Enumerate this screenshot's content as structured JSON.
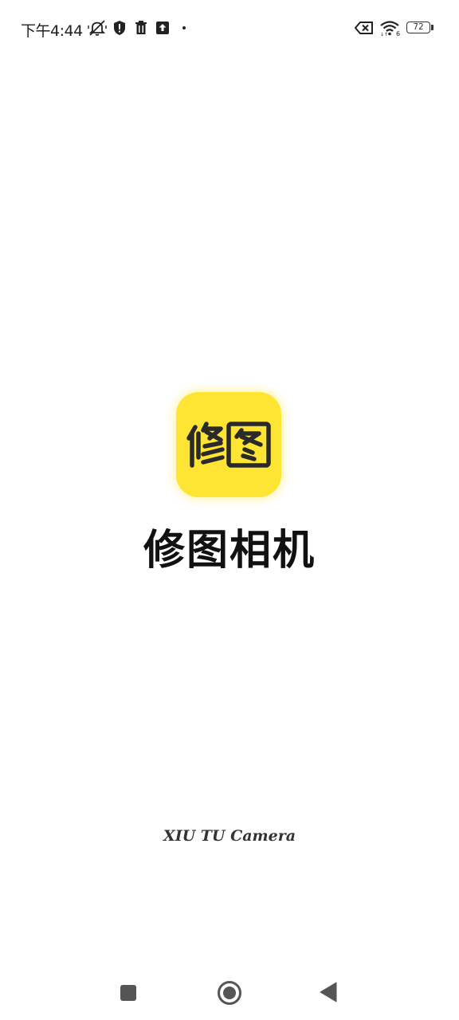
{
  "status_bar": {
    "time": "下午4:44",
    "battery_level": "72",
    "icons_left": [
      "mute-icon",
      "shield-icon",
      "trash-icon",
      "upload-icon",
      "dot-icon"
    ],
    "icons_right": [
      "sim-no-signal-icon",
      "wifi-icon",
      "battery-icon"
    ]
  },
  "splash": {
    "logo_text": "修图",
    "app_name": "修图相机",
    "subtitle": "XIU TU Camera",
    "logo_color": "#ffe533"
  },
  "nav_bar": {
    "buttons": [
      "recent-apps-button",
      "home-button",
      "back-button"
    ]
  }
}
